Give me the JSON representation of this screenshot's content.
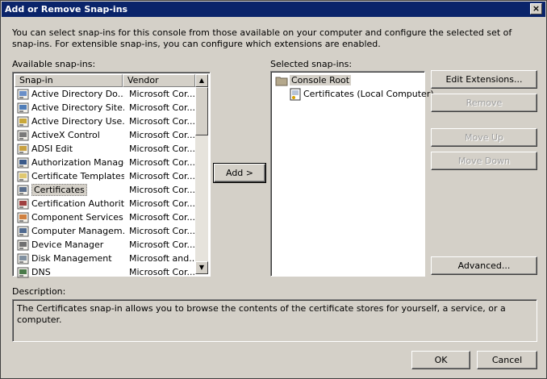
{
  "window": {
    "title": "Add or Remove Snap-ins",
    "close_glyph": "×"
  },
  "intro": "You can select snap-ins for this console from those available on your computer and configure the selected set of snap-ins. For extensible snap-ins, you can configure which extensions are enabled.",
  "available": {
    "label": "Available snap-ins:",
    "columns": {
      "name": "Snap-in",
      "vendor": "Vendor"
    },
    "items": [
      {
        "name": "Active Directory Do...",
        "vendor": "Microsoft Cor...",
        "icon": "active-directory-domains-icon"
      },
      {
        "name": "Active Directory Site...",
        "vendor": "Microsoft Cor...",
        "icon": "active-directory-sites-icon"
      },
      {
        "name": "Active Directory Use...",
        "vendor": "Microsoft Cor...",
        "icon": "active-directory-users-icon"
      },
      {
        "name": "ActiveX Control",
        "vendor": "Microsoft Cor...",
        "icon": "activex-icon"
      },
      {
        "name": "ADSI Edit",
        "vendor": "Microsoft Cor...",
        "icon": "adsi-edit-icon"
      },
      {
        "name": "Authorization Manager",
        "vendor": "Microsoft Cor...",
        "icon": "authorization-manager-icon"
      },
      {
        "name": "Certificate Templates",
        "vendor": "Microsoft Cor...",
        "icon": "certificate-templates-icon"
      },
      {
        "name": "Certificates",
        "vendor": "Microsoft Cor...",
        "icon": "certificates-icon",
        "selected": true
      },
      {
        "name": "Certification Authority",
        "vendor": "Microsoft Cor...",
        "icon": "certification-authority-icon"
      },
      {
        "name": "Component Services",
        "vendor": "Microsoft Cor...",
        "icon": "component-services-icon"
      },
      {
        "name": "Computer Managem...",
        "vendor": "Microsoft Cor...",
        "icon": "computer-management-icon"
      },
      {
        "name": "Device Manager",
        "vendor": "Microsoft Cor...",
        "icon": "device-manager-icon"
      },
      {
        "name": "Disk Management",
        "vendor": "Microsoft and...",
        "icon": "disk-management-icon"
      },
      {
        "name": "DNS",
        "vendor": "Microsoft Cor...",
        "icon": "dns-icon"
      }
    ],
    "scroll_up_glyph": "▲",
    "scroll_down_glyph": "▼"
  },
  "add_button": "Add >",
  "selected": {
    "label": "Selected snap-ins:",
    "root": "Console Root",
    "child": "Certificates (Local Computer)"
  },
  "buttons": {
    "edit_extensions": "Edit Extensions...",
    "remove": "Remove",
    "move_up": "Move Up",
    "move_down": "Move Down",
    "advanced": "Advanced...",
    "ok": "OK",
    "cancel": "Cancel"
  },
  "description": {
    "label": "Description:",
    "text": "The Certificates snap-in allows you to browse the contents of the certificate stores for yourself, a service, or a computer."
  },
  "colors": {
    "titlebar": "#0a246a",
    "face": "#d4d0c8"
  }
}
